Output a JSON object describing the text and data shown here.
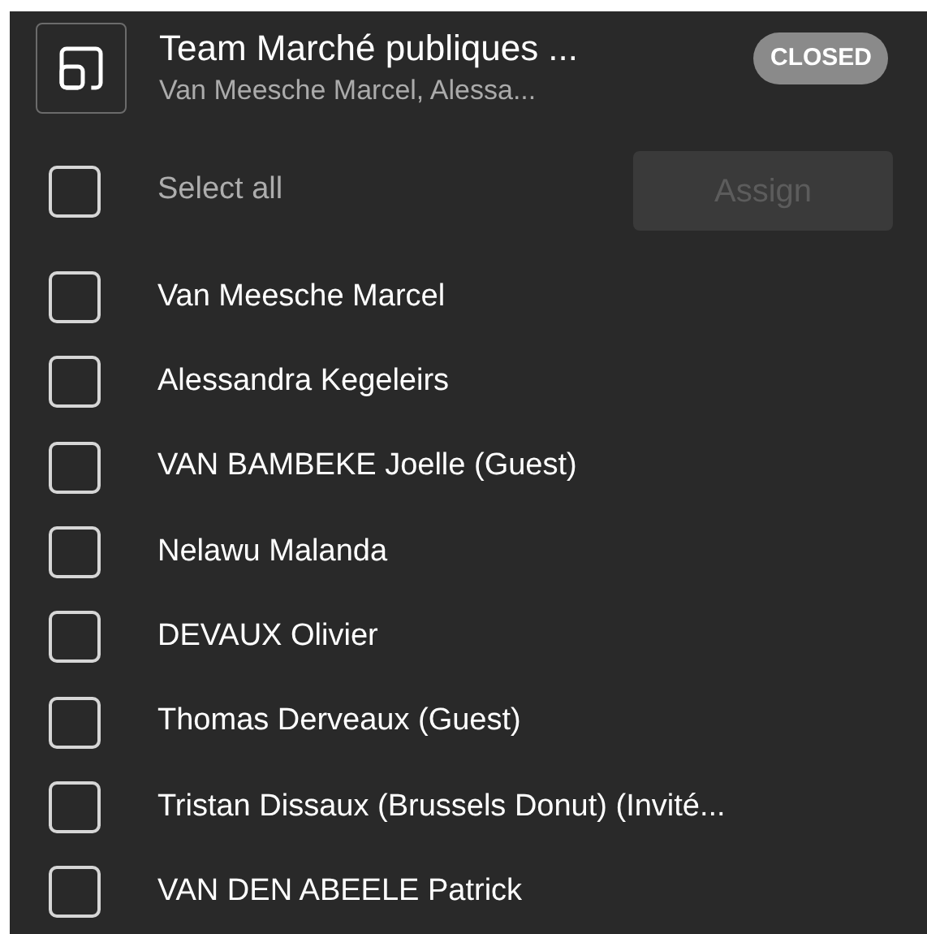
{
  "header": {
    "title": "Team Marché publiques ...",
    "subtitle": "Van Meesche Marcel, Alessa...",
    "badge": "CLOSED"
  },
  "select_all": {
    "label": "Select all",
    "checked": false
  },
  "assign_button": {
    "label": "Assign",
    "disabled": true
  },
  "members": [
    {
      "name": "Van Meesche Marcel",
      "checked": false
    },
    {
      "name": "Alessandra Kegeleirs",
      "checked": false
    },
    {
      "name": "VAN BAMBEKE Joelle (Guest)",
      "checked": false
    },
    {
      "name": "Nelawu Malanda",
      "checked": false
    },
    {
      "name": "DEVAUX Olivier",
      "checked": false
    },
    {
      "name": "Thomas Derveaux (Guest)",
      "checked": false
    },
    {
      "name": "Tristan Dissaux (Brussels Donut) (Invité...",
      "checked": false
    },
    {
      "name": "VAN DEN ABEELE Patrick",
      "checked": false
    }
  ]
}
